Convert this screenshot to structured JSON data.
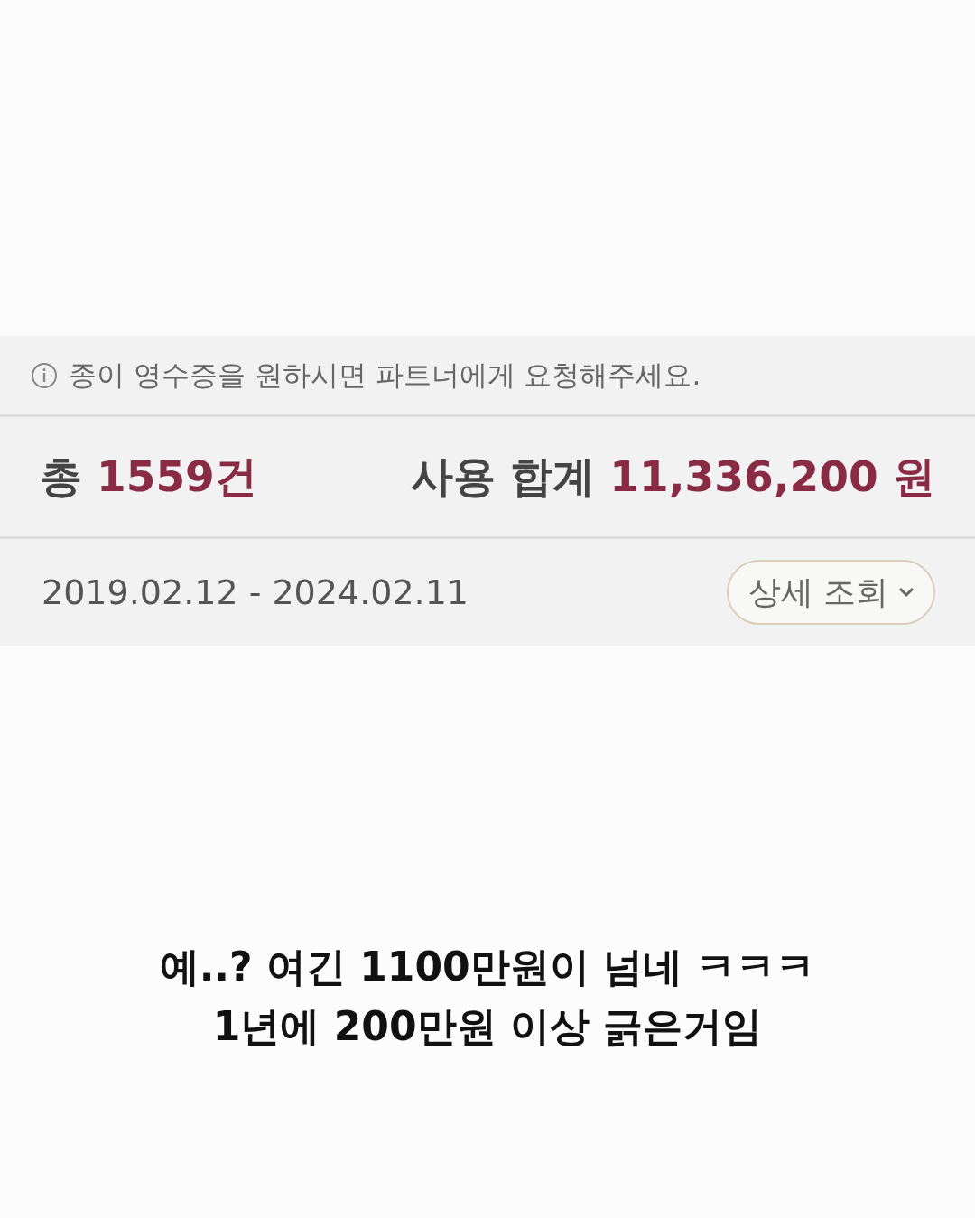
{
  "notice": {
    "text": "종이 영수증을 원하시면 파트너에게 요청해주세요."
  },
  "summary": {
    "count_label": "총",
    "count": "1559건",
    "total_label": "사용 합계",
    "total": "11,336,200 원"
  },
  "period": {
    "range": "2019.02.12 - 2024.02.11",
    "button": "상세 조회"
  },
  "caption": [
    "예..? 여긴 1100만원이 넘네 ㅋㅋㅋ",
    "1년에 200만원 이상 긁은거임"
  ]
}
